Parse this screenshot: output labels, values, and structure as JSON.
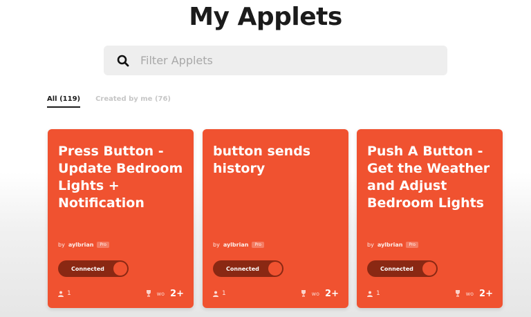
{
  "page": {
    "title": "My Applets"
  },
  "search": {
    "placeholder": "Filter Applets",
    "value": ""
  },
  "tabs": [
    {
      "label": "All (119)",
      "active": true
    },
    {
      "label": "Created by me (76)",
      "active": false
    }
  ],
  "colors": {
    "card": "#f05230",
    "toggle_track": "#8a2813"
  },
  "cards": [
    {
      "title": "Press Button - Update Bedroom Lights + Notification",
      "by": "by",
      "author": "aylbrian",
      "badge": "Pro",
      "status": "Connected",
      "users": "1",
      "service_icon_1": "wo",
      "more": "2+"
    },
    {
      "title": "button sends history",
      "by": "by",
      "author": "aylbrian",
      "badge": "Pro",
      "status": "Connected",
      "users": "1",
      "service_icon_1": "wo",
      "more": "2+"
    },
    {
      "title": "Push A Button - Get the Weather and Adjust Bedroom Lights",
      "by": "by",
      "author": "aylbrian",
      "badge": "Pro",
      "status": "Connected",
      "users": "1",
      "service_icon_1": "wo",
      "more": "2+"
    }
  ]
}
